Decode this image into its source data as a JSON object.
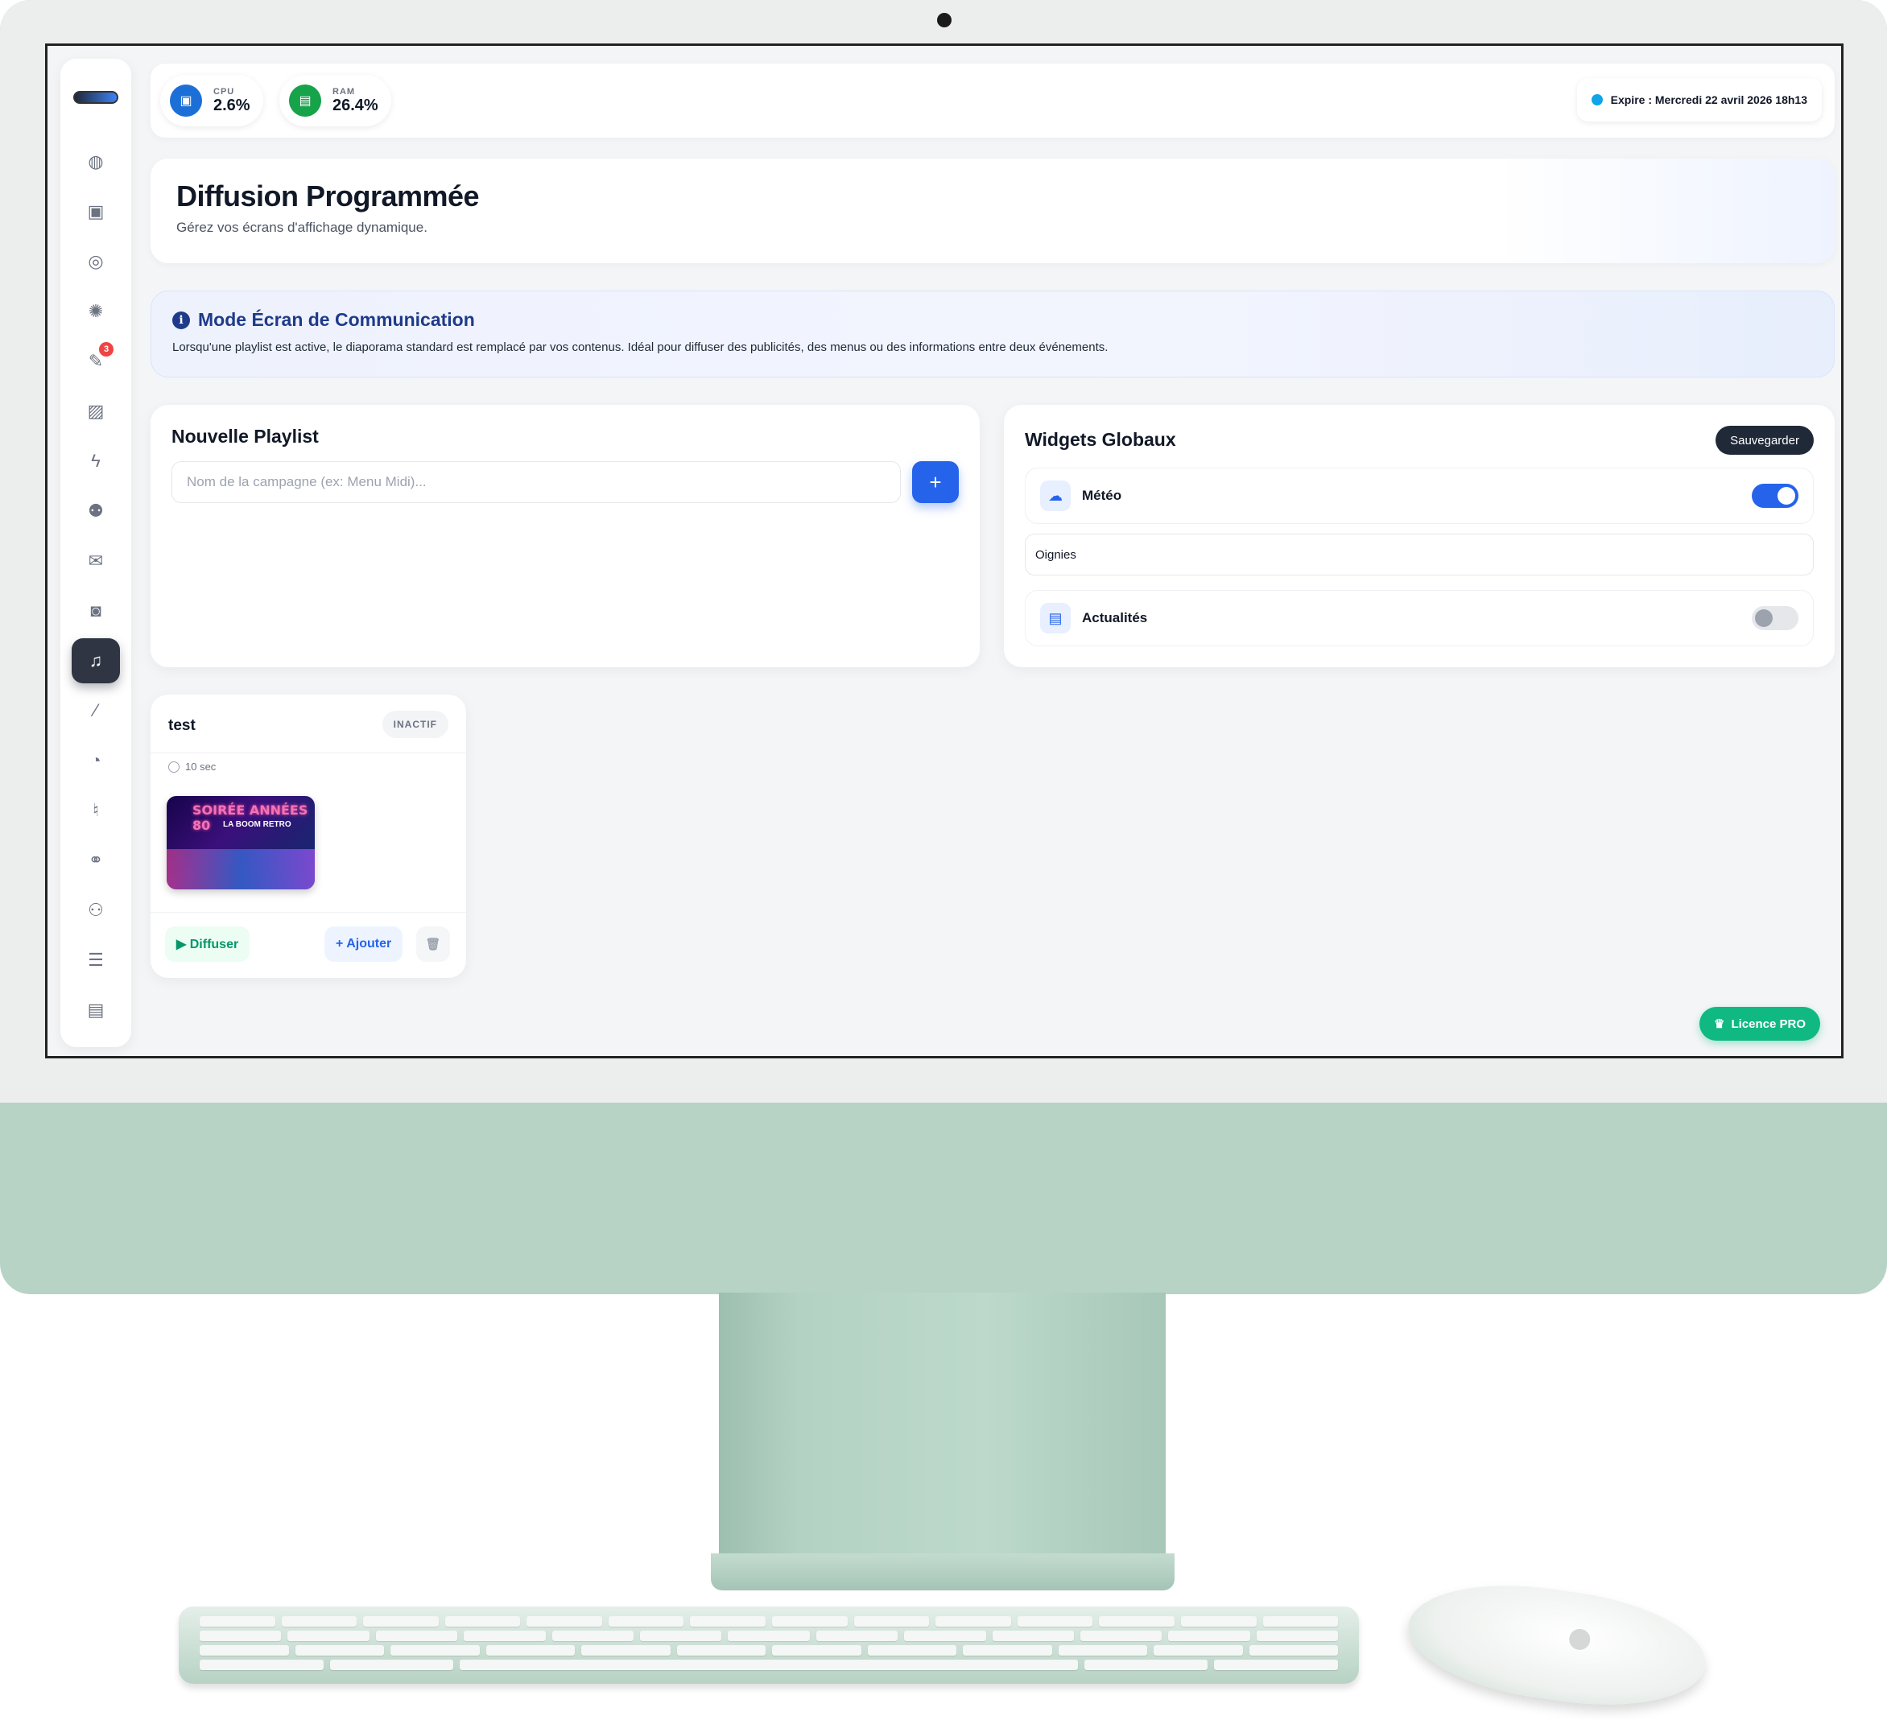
{
  "sidebar": {
    "items": [
      {
        "name": "dashboard-icon",
        "glyph": "◍"
      },
      {
        "name": "gallery-icon",
        "glyph": "▣"
      },
      {
        "name": "globe-icon",
        "glyph": "◎"
      },
      {
        "name": "settings-icon",
        "glyph": "✺"
      },
      {
        "name": "tools-icon",
        "glyph": "✎",
        "badge": "3"
      },
      {
        "name": "image-icon",
        "glyph": "▨"
      },
      {
        "name": "bolt-icon",
        "glyph": "ϟ"
      },
      {
        "name": "users-icon",
        "glyph": "⚉"
      },
      {
        "name": "chat-icon",
        "glyph": "✉"
      },
      {
        "name": "camera-icon",
        "glyph": "◙"
      },
      {
        "name": "music-sparkle-icon",
        "glyph": "♫",
        "active": true
      },
      {
        "name": "magic-wand-icon",
        "glyph": "⁄"
      },
      {
        "name": "pie-chart-icon",
        "glyph": "◔"
      },
      {
        "name": "microphone-icon",
        "glyph": "♮"
      },
      {
        "name": "handshake-icon",
        "glyph": "⚭"
      },
      {
        "name": "user-settings-icon",
        "glyph": "⚇"
      },
      {
        "name": "sliders-icon",
        "glyph": "☰"
      },
      {
        "name": "film-icon",
        "glyph": "▤"
      }
    ]
  },
  "topbar": {
    "cpu_label": "CPU",
    "cpu_value": "2.6%",
    "ram_label": "RAM",
    "ram_value": "26.4%",
    "expire_text": "Expire : Mercredi 22 avril 2026 18h13"
  },
  "header": {
    "title": "Diffusion Programmée",
    "subtitle": "Gérez vos écrans d'affichage dynamique."
  },
  "info": {
    "title": "Mode Écran de Communication",
    "text": "Lorsqu'une playlist est active, le diaporama standard est remplacé par vos contenus. Idéal pour diffuser des publicités, des menus ou des informations entre deux événements."
  },
  "new_playlist": {
    "title": "Nouvelle Playlist",
    "placeholder": "Nom de la campagne (ex: Menu Midi)...",
    "add_label": "+"
  },
  "widgets": {
    "title": "Widgets Globaux",
    "save_label": "Sauvegarder",
    "weather_label": "Météo",
    "weather_on": true,
    "city_value": "Oignies",
    "news_label": "Actualités",
    "news_on": false
  },
  "playlist": {
    "name": "test",
    "status": "INACTIF",
    "duration": "10 sec",
    "thumb_title": "SOIRÉE ANNÉES 80",
    "thumb_subtitle": "LA BOOM RETRO",
    "diffuser_label": "▶ Diffuser",
    "ajouter_label": "+ Ajouter",
    "trash_label": "🗑"
  },
  "licence": {
    "label": "Licence PRO"
  },
  "colors": {
    "accent": "#2563eb",
    "success": "#10b981",
    "dark": "#1f2937",
    "imac_green": "#b6d3c6"
  }
}
